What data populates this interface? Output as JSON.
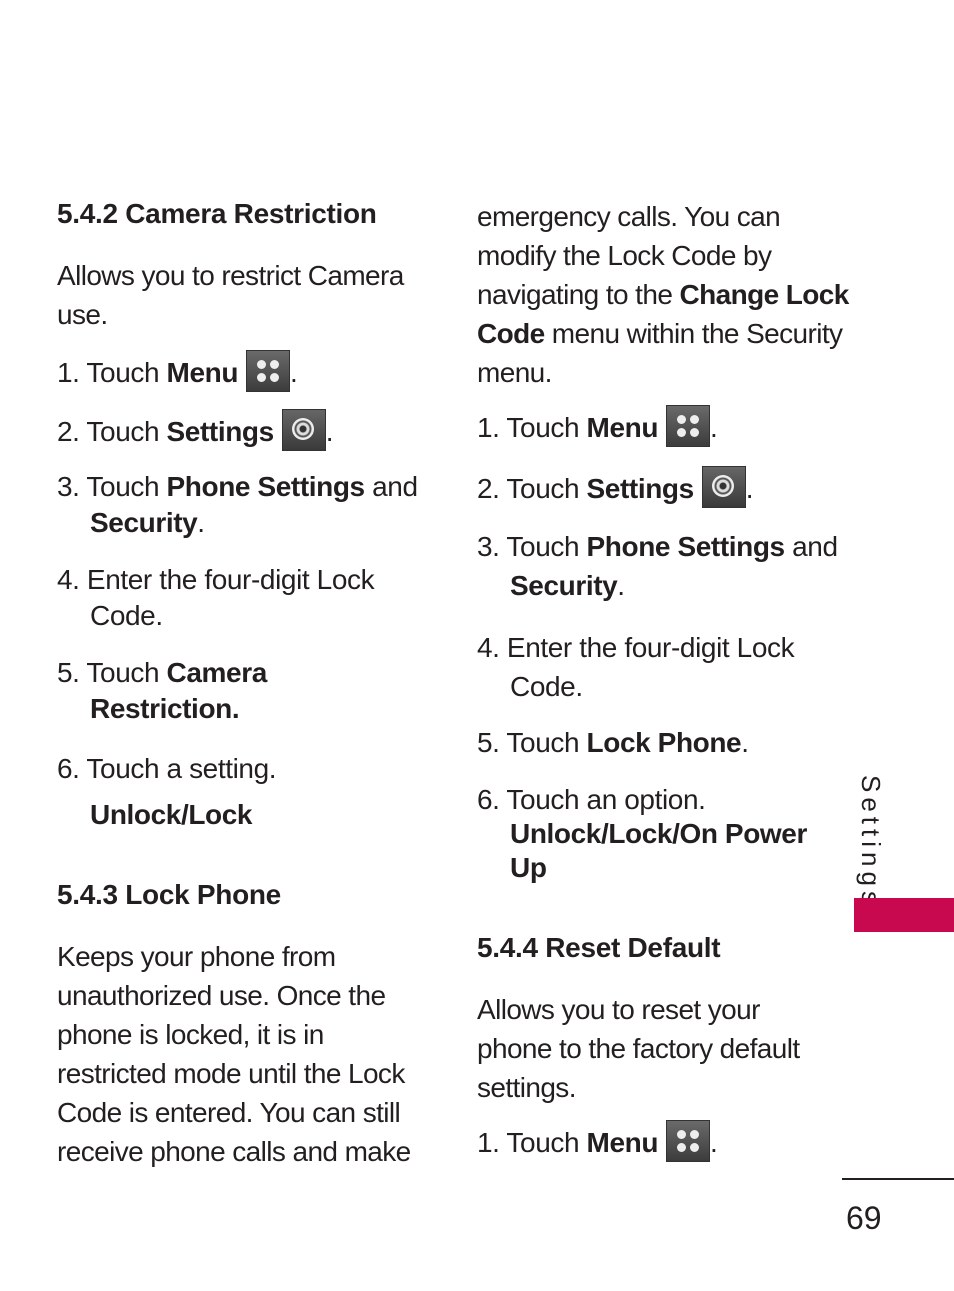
{
  "left": {
    "s542_title": "5.4.2 Camera Restriction",
    "s542_intro1": "Allows you to restrict Camera",
    "s542_intro2": "use.",
    "steps": {
      "s1a": "1. Touch ",
      "s1b": "Menu",
      "s1c": ".",
      "s2a": "2. Touch ",
      "s2b": "Settings",
      "s2c": ".",
      "s3a": "3. Touch ",
      "s3b": "Phone Settings",
      "s3c": " and",
      "s3d": "Security",
      "s3e": ".",
      "s4a": "4. Enter the four-digit Lock",
      "s4b": "Code.",
      "s5a": "5. Touch ",
      "s5b": "Camera",
      "s5c": "Restriction.",
      "s6a": "6. Touch a setting.",
      "s6b": "Unlock/Lock"
    },
    "s543_title": "5.4.3 Lock Phone",
    "s543_lines": [
      "Keeps your phone from",
      "unauthorized use. Once the",
      "phone is locked, it is in",
      "restricted mode until the Lock",
      "Code is entered. You can still",
      "receive phone calls and make"
    ]
  },
  "right": {
    "cont1": "emergency calls.  You can",
    "cont2": "modify the Lock Code by",
    "cont3a": "navigating to the ",
    "cont3b": "Change Lock",
    "cont4a": "Code",
    "cont4b": " menu within the Security",
    "cont5": "menu.",
    "steps": {
      "s1a": "1. Touch ",
      "s1b": "Menu",
      "s1c": ".",
      "s2a": "2. Touch ",
      "s2b": "Settings",
      "s2c": ".",
      "s3a": "3. Touch ",
      "s3b": "Phone Settings",
      "s3c": " and",
      "s3d": "Security",
      "s3e": ".",
      "s4a": "4. Enter the four-digit Lock",
      "s4b": "Code.",
      "s5a": "5. Touch ",
      "s5b": "Lock Phone",
      "s5c": ".",
      "s6a": "6. Touch an option.",
      "s6b": "Unlock/Lock/On Power",
      "s6c": "Up"
    },
    "s544_title": "5.4.4 Reset Default",
    "s544_lines": [
      "Allows you to reset your",
      "phone to the factory default",
      "settings."
    ],
    "s544_s1a": "1. Touch ",
    "s544_s1b": "Menu",
    "s544_s1c": "."
  },
  "side_tab": "Settings",
  "page_number": "69",
  "accent_color": "#c8094f"
}
